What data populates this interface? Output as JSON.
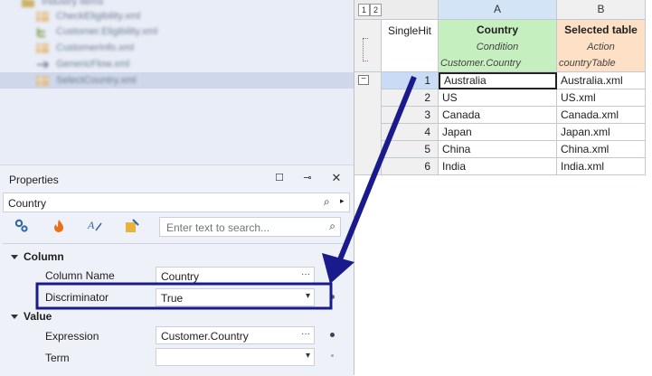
{
  "tree": {
    "items": [
      {
        "label": "Industry items",
        "icon": "folder-icon"
      },
      {
        "label": "CheckEligibility.xml",
        "icon": "decision-table-icon"
      },
      {
        "label": "Customer.Eligibility.xml",
        "icon": "tree-icon"
      },
      {
        "label": "CustomerInfo.xml",
        "icon": "decision-table-icon"
      },
      {
        "label": "GenericFlow.xml",
        "icon": "flow-icon"
      },
      {
        "label": "SelectCountry.xml",
        "icon": "decision-table-icon"
      }
    ]
  },
  "properties": {
    "title": "Properties",
    "selected_object": "Country",
    "search_placeholder": "Enter text to search...",
    "categories": [
      {
        "name": "Column",
        "rows": [
          {
            "label": "Column Name",
            "value": "Country",
            "button": "···"
          },
          {
            "label": "Discriminator",
            "value": "True",
            "button": "▾"
          }
        ]
      },
      {
        "name": "Value",
        "rows": [
          {
            "label": "Expression",
            "value": "Customer.Country",
            "button": "···"
          },
          {
            "label": "Term",
            "value": "",
            "button": "▾"
          }
        ]
      }
    ]
  },
  "grid": {
    "levels": [
      "1",
      "2"
    ],
    "single_hit_label": "SingleHit",
    "columns": [
      {
        "letter": "A",
        "title": "Country",
        "kind": "Condition",
        "expression": "Customer.Country",
        "color": "#c6efc0"
      },
      {
        "letter": "B",
        "title": "Selected table",
        "kind": "Action",
        "expression": "countryTable",
        "color": "#fde0c5"
      }
    ],
    "rows": [
      {
        "num": "1",
        "a": "Australia",
        "b": "Australia.xml"
      },
      {
        "num": "2",
        "a": "US",
        "b": "US.xml"
      },
      {
        "num": "3",
        "a": "Canada",
        "b": "Canada.xml"
      },
      {
        "num": "4",
        "a": "Japan",
        "b": "Japan.xml"
      },
      {
        "num": "5",
        "a": "China",
        "b": "China.xml"
      },
      {
        "num": "6",
        "a": "India",
        "b": "India.xml"
      }
    ]
  },
  "colors": {
    "annotation": "#1a1a8c",
    "selected_cell": "#c8dcf5"
  }
}
